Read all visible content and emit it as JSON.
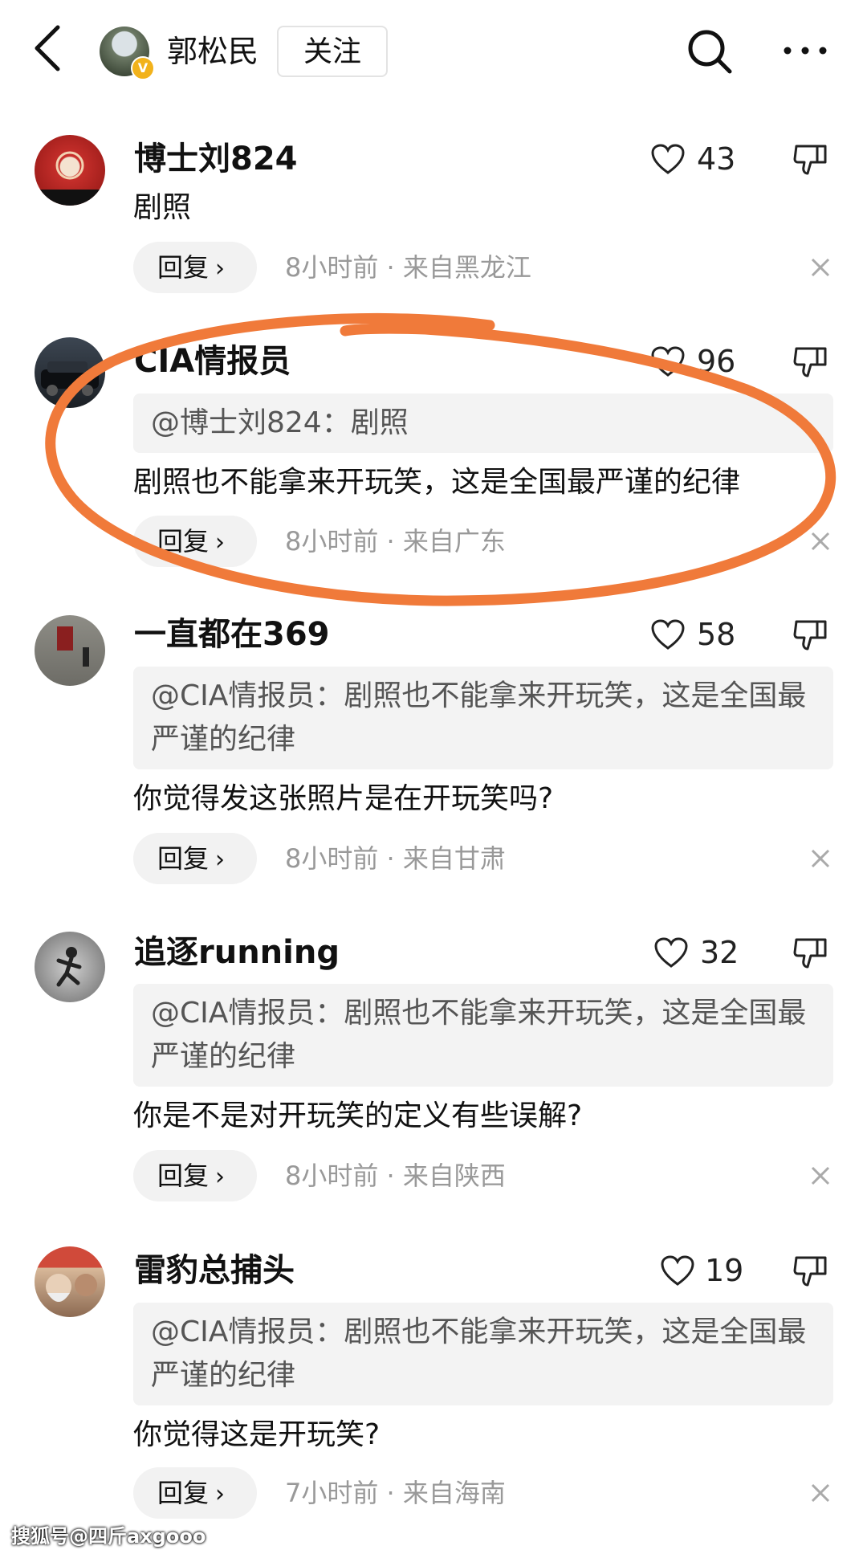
{
  "header": {
    "author_name": "郭松民",
    "follow_label": "关注",
    "icons": [
      "back-icon",
      "search-icon",
      "more-icon"
    ]
  },
  "comments": [
    {
      "name": "博士刘824",
      "likes": "43",
      "quote": "",
      "body": "剧照",
      "reply_label": "回复",
      "meta": "8小时前 · 来自黑龙江"
    },
    {
      "name": "CIA情报员",
      "likes": "96",
      "quote": "@博士刘824：剧照",
      "body": "剧照也不能拿来开玩笑，这是全国最严谨的纪律",
      "reply_label": "回复",
      "meta": "8小时前 · 来自广东"
    },
    {
      "name": "一直都在369",
      "likes": "58",
      "quote": "@CIA情报员：剧照也不能拿来开玩笑，这是全国最严谨的纪律",
      "body": "你觉得发这张照片是在开玩笑吗?",
      "reply_label": "回复",
      "meta": "8小时前 · 来自甘肃"
    },
    {
      "name": "追逐running",
      "likes": "32",
      "quote": "@CIA情报员：剧照也不能拿来开玩笑，这是全国最严谨的纪律",
      "body": "你是不是对开玩笑的定义有些误解?",
      "reply_label": "回复",
      "meta": "8小时前 · 来自陕西"
    },
    {
      "name": "雷豹总捕头",
      "likes": "19",
      "quote": "@CIA情报员：剧照也不能拿来开玩笑，这是全国最严谨的纪律",
      "body": "你觉得这是开玩笑?",
      "reply_label": "回复",
      "meta": "7小时前 · 来自海南"
    }
  ],
  "annotation_color": "#f07a3a",
  "watermark": "搜狐号@四斤axgooo"
}
